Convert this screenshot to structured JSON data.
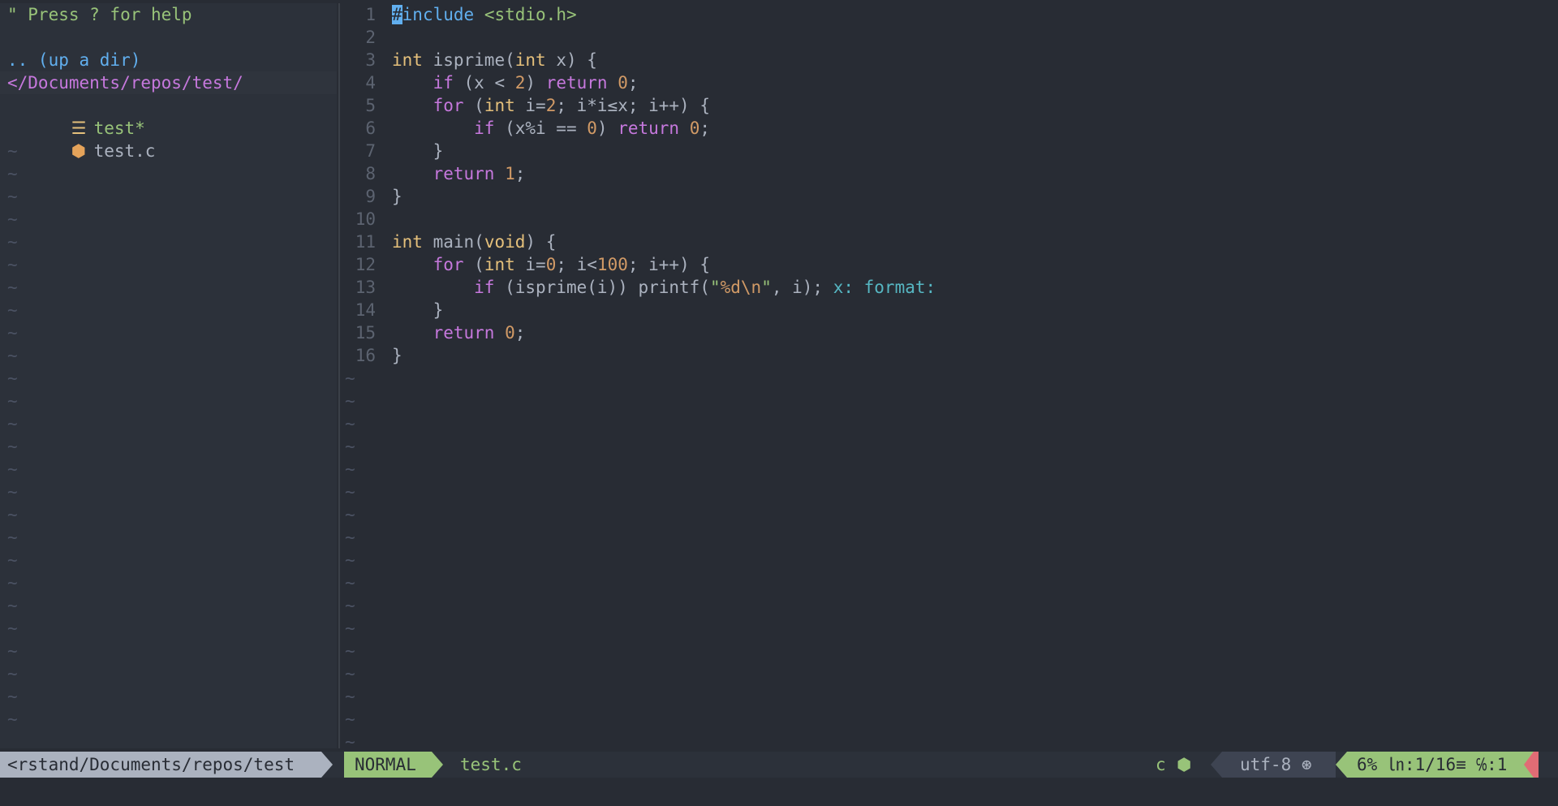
{
  "tree": {
    "help_line": "\" Press ? for help",
    "up_dir": ".. (up a dir)",
    "current_dir": "</Documents/repos/test/",
    "entries": [
      {
        "icon": "text-file-icon",
        "name": "test*"
      },
      {
        "icon": "c-file-icon",
        "name": "test.c"
      }
    ],
    "tilde": "~"
  },
  "editor": {
    "line_numbers": [
      "1",
      "2",
      "3",
      "4",
      "5",
      "6",
      "7",
      "8",
      "9",
      "10",
      "11",
      "12",
      "13",
      "14",
      "15",
      "16"
    ],
    "lines": [
      "#include <stdio.h>",
      "",
      "int isprime(int x) {",
      "    if (x < 2) return 0;",
      "    for (int i=2; i*i≤x; i++) {",
      "        if (x%i == 0) return 0;",
      "    }",
      "    return 1;",
      "}",
      "",
      "int main(void) {",
      "    for (int i=0; i<100; i++) {",
      "        if (isprime(i)) printf(\"%d\\n\", i);",
      "    }",
      "    return 0;",
      "}"
    ],
    "virtual_text": "x: format:",
    "tilde": "~"
  },
  "statusline": {
    "tree_path": "<rstand/Documents/repos/test",
    "mode": "NORMAL",
    "filename": "test.c",
    "filetype": "c",
    "encoding": "utf-8",
    "position": "6% ㏑:1/16≡ ℅:1"
  },
  "colors": {
    "background": "#282c34",
    "green": "#98c379",
    "purple": "#c678dd",
    "blue": "#61afef",
    "yellow": "#e5c07b",
    "orange": "#d19a66",
    "red": "#e06c75"
  }
}
